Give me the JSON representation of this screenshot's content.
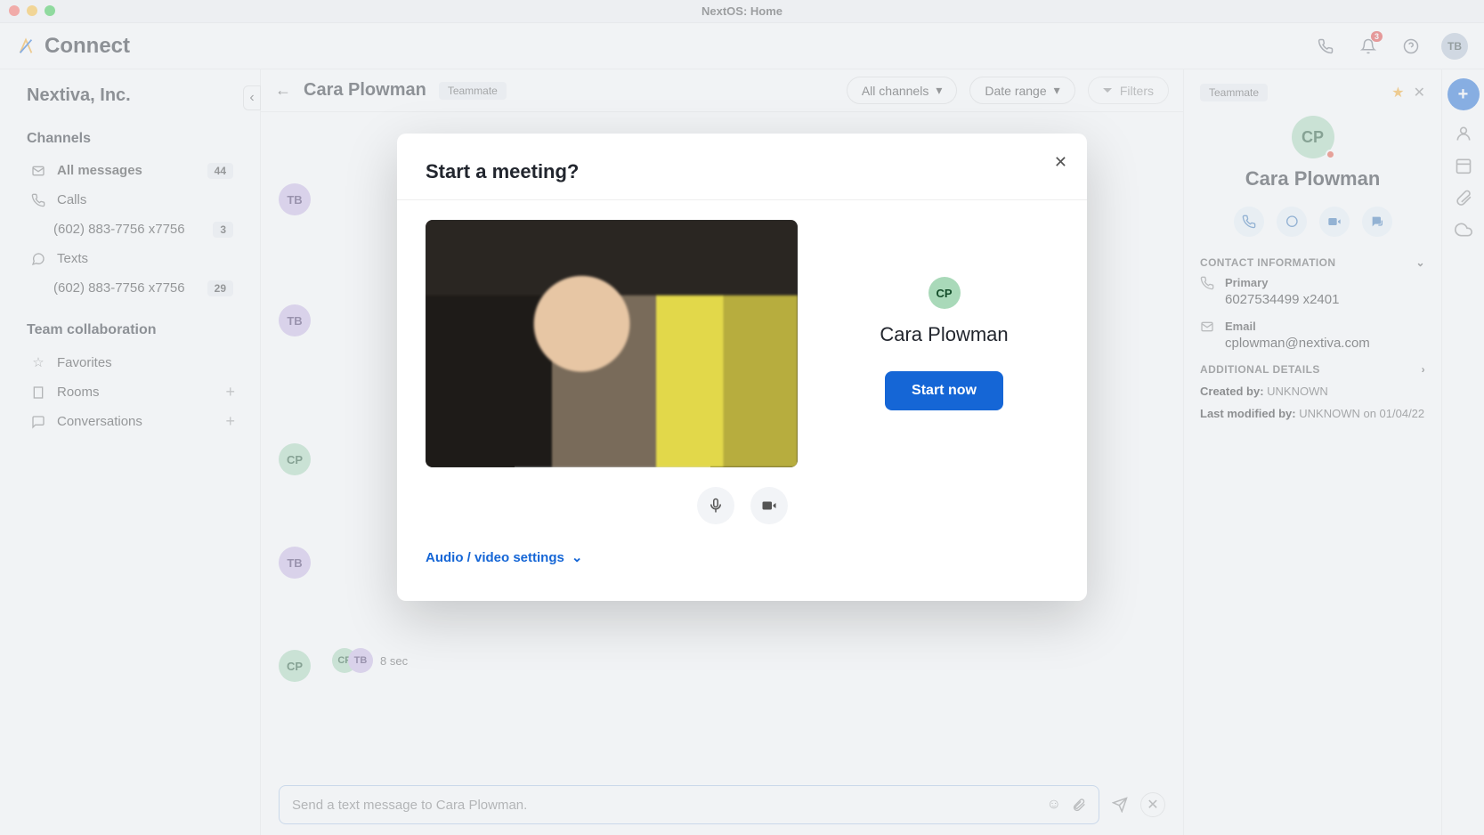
{
  "window_title": "NextOS: Home",
  "brand": "Connect",
  "notifications_count": "3",
  "user_initials": "TB",
  "org_name": "Nextiva, Inc.",
  "sidebar": {
    "channels_heading": "Channels",
    "team_heading": "Team collaboration",
    "items": [
      {
        "label": "All messages",
        "badge": "44",
        "bold": true
      },
      {
        "label": "Calls"
      },
      {
        "label": "(602) 883-7756 x7756",
        "badge": "3",
        "sub": true
      },
      {
        "label": "Texts"
      },
      {
        "label": "(602) 883-7756 x7756",
        "badge": "29",
        "sub": true
      }
    ],
    "team_items": [
      {
        "label": "Favorites"
      },
      {
        "label": "Rooms",
        "add": true
      },
      {
        "label": "Conversations",
        "add": true
      }
    ]
  },
  "thread": {
    "name": "Cara Plowman",
    "role": "Teammate",
    "filter_channels": "All channels",
    "filter_date": "Date range",
    "filter_label": "Filters",
    "composer_placeholder": "Send a text message to Cara Plowman.",
    "call_duration": "8 sec"
  },
  "profile": {
    "role": "Teammate",
    "initials": "CP",
    "name": "Cara Plowman",
    "contact_section": "CONTACT INFORMATION",
    "primary_label": "Primary",
    "primary_value": "6027534499 x2401",
    "email_label": "Email",
    "email_value": "cplowman@nextiva.com",
    "additional_section": "ADDITIONAL DETAILS",
    "created_by_label": "Created by:",
    "created_by_value": "UNKNOWN",
    "modified_by_label": "Last modified by:",
    "modified_by_value": "UNKNOWN on 01/04/22"
  },
  "modal": {
    "title": "Start a meeting?",
    "invitee_initials": "CP",
    "invitee_name": "Cara Plowman",
    "start_label": "Start now",
    "settings_label": "Audio / video settings"
  }
}
